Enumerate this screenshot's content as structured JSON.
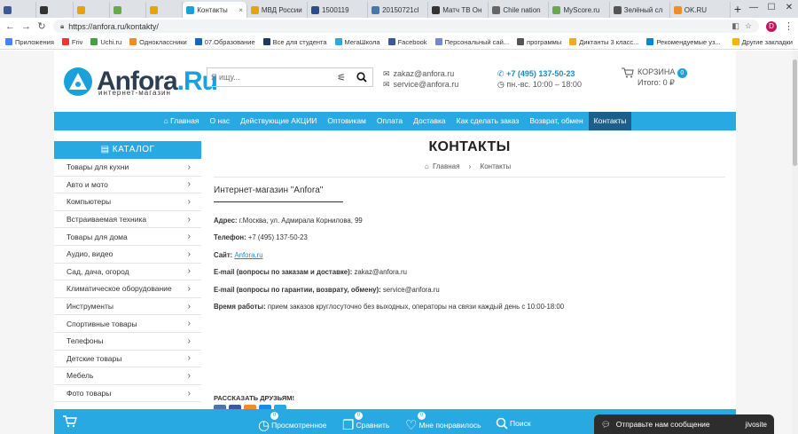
{
  "browser": {
    "tabs": [
      {
        "label": "",
        "color": "#3b5998"
      },
      {
        "label": "",
        "color": "#333333"
      },
      {
        "label": "",
        "color": "#e5a50a"
      },
      {
        "label": "",
        "color": "#6aa84f"
      },
      {
        "label": "",
        "color": "#e5a50a"
      },
      {
        "label": "Контакты",
        "color": "#1aa1dc",
        "active": true
      },
      {
        "label": "МВД России",
        "color": "#e5a50a"
      },
      {
        "label": "1500119",
        "color": "#2b4c8c"
      },
      {
        "label": "20150721cl",
        "color": "#4a76a8"
      },
      {
        "label": "Матч ТВ Он",
        "color": "#333333"
      },
      {
        "label": "Chile nation",
        "color": "#666666"
      },
      {
        "label": "MyScore.ru",
        "color": "#6aa84f"
      },
      {
        "label": "Зелёный сл",
        "color": "#555555"
      },
      {
        "label": "OK.RU",
        "color": "#f28c28"
      }
    ],
    "new_tab": "+",
    "url": "https://anfora.ru/kontakty/",
    "avatar_letter": "D",
    "bookmarks": [
      {
        "label": "Приложения",
        "color": "#4285f4"
      },
      {
        "label": "Friv",
        "color": "#e53935"
      },
      {
        "label": "Uchi.ru",
        "color": "#43a047"
      },
      {
        "label": "Одноклассники",
        "color": "#f28c28"
      },
      {
        "label": "07.Образование",
        "color": "#1565c0"
      },
      {
        "label": "Все для студента",
        "color": "#1e3a5f"
      },
      {
        "label": "МегаШкола",
        "color": "#29a9e1"
      },
      {
        "label": "Facebook",
        "color": "#3b5998"
      },
      {
        "label": "Персональный сай...",
        "color": "#7986cb"
      },
      {
        "label": "программы",
        "color": "#555555"
      },
      {
        "label": "Диктанты 3 класс...",
        "color": "#f9a825"
      },
      {
        "label": "Рекомендуемые уз...",
        "color": "#0288d1"
      }
    ],
    "other_bookmarks": "Другие закладки"
  },
  "site": {
    "logo_name": "Anfora",
    "logo_dot": ".Ru",
    "logo_sub": "интернет-магазин",
    "search_placeholder": "Я ищу...",
    "email1": "zakaz@anfora.ru",
    "email2": "service@anfora.ru",
    "phone": "+7 (495) 137-50-23",
    "hours": "пн.-вс. 10:00 – 18:00",
    "cart_label": "КОРЗИНА",
    "cart_count": "0",
    "cart_total": "Итого: 0 ₽",
    "accent": "#29a9e1",
    "menu": [
      {
        "label": "⌂ Главная"
      },
      {
        "label": "О нас"
      },
      {
        "label": "Действующие АКЦИИ"
      },
      {
        "label": "Оптовикам"
      },
      {
        "label": "Оплата"
      },
      {
        "label": "Доставка"
      },
      {
        "label": "Как сделать заказ"
      },
      {
        "label": "Возврат, обмен"
      },
      {
        "label": "Контакты",
        "active": true
      }
    ]
  },
  "catalog": {
    "title": "КАТАЛОГ",
    "items": [
      "Товары для кухни",
      "Авто и мото",
      "Компьютеры",
      "Встраиваемая техника",
      "Товары для дома",
      "Аудио, видео",
      "Сад, дача, огород",
      "Климатическое оборудование",
      "Инструменты",
      "Спортивные товары",
      "Телефоны",
      "Детские товары",
      "Мебель",
      "Фото товары"
    ]
  },
  "content": {
    "title": "КОНТАКТЫ",
    "crumb_home": "Главная",
    "crumb_sep": "›",
    "crumb_current": "Контакты",
    "store_title": "Интернет-магазин \"Anfora\"",
    "address_label": "Адрес:",
    "address": "г.Москва, ул. Адмирала Корнилова, 99",
    "phone_label": "Телефон:",
    "phone": "+7 (495) 137-50-23",
    "site_label": "Сайт:",
    "site": "Anfora.ru",
    "email_orders_label": "E-mail (вопросы по заказам и доставке):",
    "email_orders": "zakaz@anfora.ru",
    "email_returns_label": "E-mail (вопросы по гарантии, возврату, обмену):",
    "email_returns": "service@anfora.ru",
    "hours_label": "Время работы:",
    "hours": "прием заказов круглосуточно без выходных, операторы на связи каждый день с 10:00-18:00",
    "share_label": "РАССКАЗАТЬ ДРУЗЬЯМ!"
  },
  "bottombar": {
    "viewed_label": "Просмотренное",
    "viewed_count": "0",
    "compare_label": "Сравнить",
    "compare_count": "0",
    "liked_label": "Мне понравилось",
    "liked_count": "0",
    "search_label": "Поиск"
  },
  "chat": {
    "label": "Отправьте нам сообщение",
    "brand": "jivosite"
  }
}
